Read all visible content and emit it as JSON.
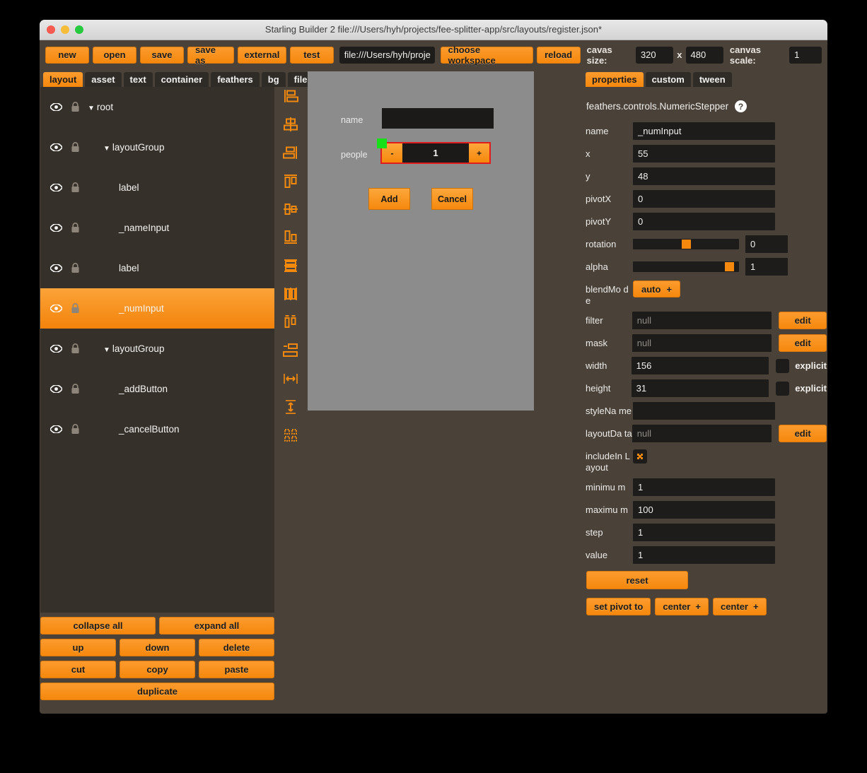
{
  "window": {
    "title": "Starling Builder 2 file:///Users/hyh/projects/fee-splitter-app/src/layouts/register.json*",
    "traffic": {
      "close": "close-button",
      "minimize": "minimize-button",
      "zoom": "zoom-button"
    }
  },
  "toolbar": {
    "buttons": [
      "new",
      "open",
      "save",
      "save as",
      "external",
      "test"
    ],
    "path_value": "file:///Users/hyh/proje",
    "choose_workspace": "choose workspace",
    "reload": "reload",
    "canvas_size_label": "cavas size:",
    "canvas_width": "320",
    "x_label": "x",
    "canvas_height": "480",
    "canvas_scale_label": "canvas scale:",
    "canvas_scale": "1"
  },
  "left": {
    "tabs": [
      {
        "label": "layout",
        "selected": true
      },
      {
        "label": "asset",
        "selected": false
      },
      {
        "label": "text",
        "selected": false
      },
      {
        "label": "container",
        "selected": false
      },
      {
        "label": "feathers",
        "selected": false
      },
      {
        "label": "bg",
        "selected": false
      },
      {
        "label": "files",
        "selected": false
      }
    ],
    "tree": [
      {
        "label": "root",
        "indent": 0,
        "caret": "▼",
        "selected": false
      },
      {
        "label": "layoutGroup",
        "indent": 1,
        "caret": "▼",
        "selected": false
      },
      {
        "label": "label",
        "indent": 2,
        "caret": "",
        "selected": false
      },
      {
        "label": "_nameInput",
        "indent": 2,
        "caret": "",
        "selected": false
      },
      {
        "label": "label",
        "indent": 2,
        "caret": "",
        "selected": false
      },
      {
        "label": "_numInput",
        "indent": 2,
        "caret": "",
        "selected": true
      },
      {
        "label": "layoutGroup",
        "indent": 1,
        "caret": "▼",
        "selected": false
      },
      {
        "label": "_addButton",
        "indent": 2,
        "caret": "",
        "selected": false
      },
      {
        "label": "_cancelButton",
        "indent": 2,
        "caret": "",
        "selected": false
      }
    ],
    "buttons": {
      "collapse_all": "collapse all",
      "expand_all": "expand all",
      "up": "up",
      "down": "down",
      "delete": "delete",
      "cut": "cut",
      "copy": "copy",
      "paste": "paste",
      "duplicate": "duplicate"
    }
  },
  "align_tools": [
    "align-left-icon",
    "align-center-horizontal-icon",
    "align-right-icon",
    "align-top-icon",
    "align-middle-vertical-icon",
    "align-bottom-icon",
    "distribute-vertical-icon",
    "distribute-horizontal-icon",
    "distribute-spacing-icon",
    "stack-icon",
    "match-width-icon",
    "match-height-icon",
    "grid-layout-icon"
  ],
  "canvas": {
    "name_label": "name",
    "name_value": "",
    "people_label": "people",
    "stepper_minus": "-",
    "stepper_value": "1",
    "stepper_plus": "+",
    "add_button": "Add",
    "cancel_button": "Cancel",
    "selection_color": "#e01b1b",
    "pivot_color": "#18e018",
    "stage_color": "#8c8c8c"
  },
  "right": {
    "tabs": [
      {
        "label": "properties",
        "selected": true
      },
      {
        "label": "custom",
        "selected": false
      },
      {
        "label": "tween",
        "selected": false
      }
    ],
    "class_name": "feathers.controls.NumericStepper",
    "help": "?",
    "fields": {
      "name": {
        "label": "name",
        "value": "_numInput"
      },
      "x": {
        "label": "x",
        "value": "55"
      },
      "y": {
        "label": "y",
        "value": "48"
      },
      "pivotX": {
        "label": "pivotX",
        "value": "0"
      },
      "pivotY": {
        "label": "pivotY",
        "value": "0"
      },
      "rotation": {
        "label": "rotation",
        "value": "0",
        "knob_pct": 50
      },
      "alpha": {
        "label": "alpha",
        "value": "1",
        "knob_pct": 95
      },
      "blendMode": {
        "label": "blendMo de",
        "value": "auto",
        "caret": "+"
      },
      "filter": {
        "label": "filter",
        "value": "null",
        "edit": "edit"
      },
      "mask": {
        "label": "mask",
        "value": "null",
        "edit": "edit"
      },
      "width": {
        "label": "width",
        "value": "156",
        "checkbox": "explicit",
        "checked": false
      },
      "height": {
        "label": "height",
        "value": "31",
        "checkbox": "explicit",
        "checked": false
      },
      "styleName": {
        "label": "styleNa me",
        "value": ""
      },
      "layoutData": {
        "label": "layoutDa ta",
        "value": "null",
        "edit": "edit"
      },
      "includeInLayout": {
        "label": "includeIn Layout",
        "checked": true
      },
      "minimum": {
        "label": "minimu m",
        "value": "1"
      },
      "maximum": {
        "label": "maximu m",
        "value": "100"
      },
      "step": {
        "label": "step",
        "value": "1"
      },
      "value": {
        "label": "value",
        "value": "1"
      }
    },
    "reset": "reset",
    "set_pivot_to": "set pivot to",
    "center_h": "center",
    "center_v": "center",
    "center_caret": "+"
  },
  "colors": {
    "accent": "#f6880d",
    "panel": "#4a4238",
    "tree_bg": "#353029",
    "field_bg": "#1e1c1a"
  }
}
